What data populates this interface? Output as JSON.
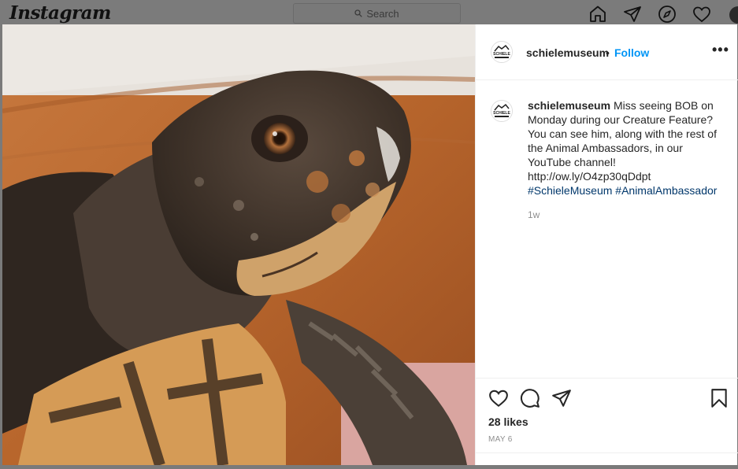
{
  "topbar": {
    "logo": "Instagram",
    "search_placeholder": "Search"
  },
  "nav_icons": [
    "home-icon",
    "direct-icon",
    "explore-icon",
    "activity-heart-icon",
    "profile-avatar"
  ],
  "post": {
    "username": "schielemuseum",
    "separator": "•",
    "follow_label": "Follow",
    "more_label": "•••",
    "caption_text": "Miss seeing BOB on Monday during our Creature Feature? You can see him, along with the rest of the Animal Ambassadors, in our YouTube channel! http://ow.ly/O4zp30qDdpt",
    "hashtags": [
      "#SchieleMuseum",
      "#AnimalAmbassador"
    ],
    "age": "1w",
    "likes": "28 likes",
    "date": "MAY 6",
    "avatar_text": "SCHIELE"
  },
  "colors": {
    "follow": "#0095f6",
    "hashtag": "#00376b",
    "muted": "#8e8e8e",
    "text": "#262626"
  }
}
